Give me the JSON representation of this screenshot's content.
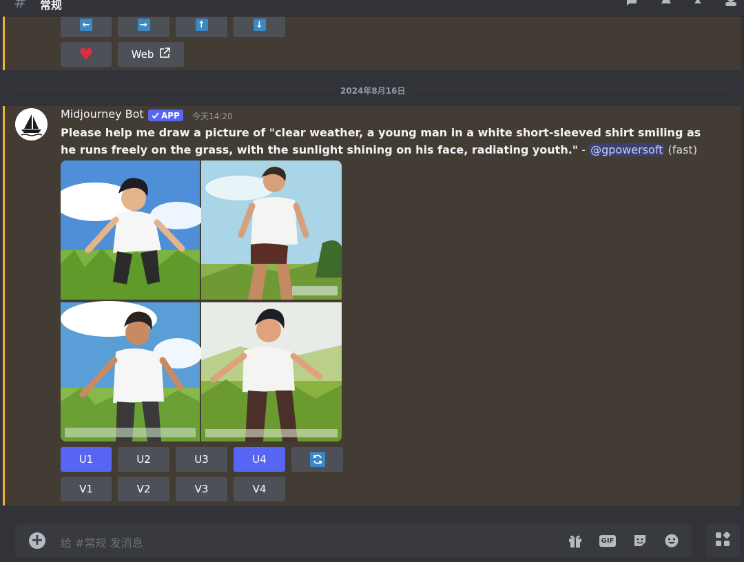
{
  "channel": {
    "hash": "#",
    "name": "常规"
  },
  "top_buttons": {
    "arrows": [
      "←",
      "→",
      "↑",
      "↓"
    ],
    "heart": "♥",
    "web_label": "Web"
  },
  "date_divider": "2024年8月16日",
  "message": {
    "author": "Midjourney Bot",
    "badge": "APP",
    "timestamp": "今天14:20",
    "prompt": "Please help me draw a picture of \"clear weather, a young man in a white short-sleeved shirt smiling as he runs freely on the grass, with the sunlight shining on his face, radiating youth.\"",
    "dash": " - ",
    "mention": "@gpowersoft",
    "mode": " (fast)"
  },
  "actions": {
    "upscale": [
      "U1",
      "U2",
      "U3",
      "U4"
    ],
    "upscale_selected": [
      true,
      false,
      false,
      true
    ],
    "variation": [
      "V1",
      "V2",
      "V3",
      "V4"
    ],
    "reroll_icon": "🔄"
  },
  "composer": {
    "placeholder": "给 #常规 发消息",
    "gift_icon": "gift-icon",
    "gif_label": "GIF"
  },
  "colors": {
    "accent": "#5865f2",
    "highlight_bar": "#f0b232",
    "highlight_bg": "#433c34"
  }
}
